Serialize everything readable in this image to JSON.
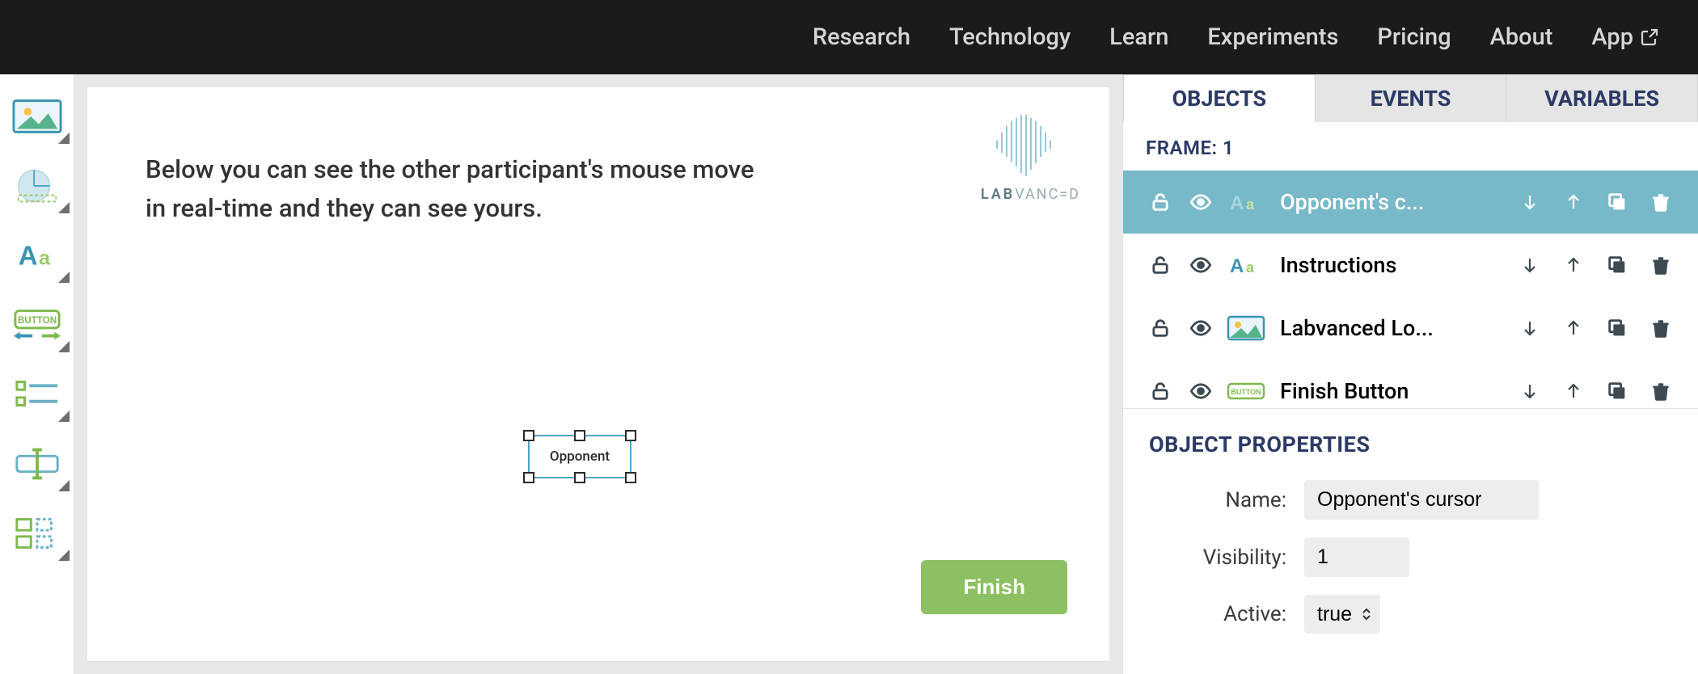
{
  "nav": {
    "items": [
      "Research",
      "Technology",
      "Learn",
      "Experiments",
      "Pricing",
      "About",
      "App"
    ]
  },
  "toolbox": {
    "tools": [
      {
        "id": "image-tool"
      },
      {
        "id": "circle-tool"
      },
      {
        "id": "text-tool"
      },
      {
        "id": "button-tool"
      },
      {
        "id": "list-tool"
      },
      {
        "id": "input-tool"
      },
      {
        "id": "grid-tool"
      }
    ]
  },
  "canvas": {
    "instructions_line1": "Below you can see the other participant's mouse move",
    "instructions_line2": "in real-time and they can see yours.",
    "logo_text_prefix": "LAB",
    "logo_text_suffix": "VANC=D",
    "finish_label": "Finish",
    "selected_label": "Opponent"
  },
  "inspector": {
    "tabs": [
      "OBJECTS",
      "EVENTS",
      "VARIABLES"
    ],
    "frame_label": "FRAME: 1",
    "objects": [
      {
        "name": "Opponent's c...",
        "type": "text",
        "selected": true
      },
      {
        "name": "Instructions",
        "type": "text",
        "selected": false
      },
      {
        "name": "Labvanced Lo...",
        "type": "image",
        "selected": false
      },
      {
        "name": "Finish Button",
        "type": "button",
        "selected": false
      }
    ],
    "props_title": "OBJECT PROPERTIES",
    "props": {
      "name_label": "Name:",
      "name_value": "Opponent's cursor",
      "visibility_label": "Visibility:",
      "visibility_value": "1",
      "active_label": "Active:",
      "active_value": "true"
    }
  }
}
